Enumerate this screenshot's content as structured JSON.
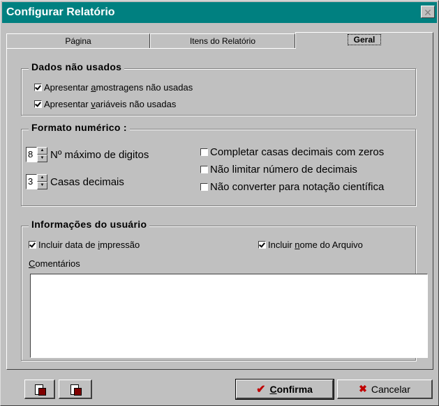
{
  "window": {
    "title": "Configurar Relatório",
    "close_glyph": "✕"
  },
  "tabs": [
    {
      "label": "Página"
    },
    {
      "label": "Itens do Relatório"
    },
    {
      "label": "Geral",
      "active": true
    }
  ],
  "unused": {
    "legend": "Dados não usados",
    "items": [
      {
        "pre": "Apresentar ",
        "key": "a",
        "post": "mostragens não usadas",
        "checked": true
      },
      {
        "pre": "Apresentar ",
        "key": "v",
        "post": "ariáveis não usadas",
        "checked": true
      }
    ]
  },
  "numeric": {
    "legend": "Formato numérico :",
    "max_digits": {
      "value": "8",
      "label": "Nº máximo de digitos"
    },
    "decimals": {
      "value": "3",
      "label": "Casas decimais"
    },
    "options": [
      {
        "label": "Completar casas decimais com zeros",
        "checked": false
      },
      {
        "label": "Não limitar número de decimais",
        "checked": false
      },
      {
        "label": "Não converter para notação científica",
        "checked": false
      }
    ]
  },
  "user_info": {
    "legend": "Informações do usuário",
    "print_date": {
      "pre": "Incluir data de ",
      "key": "i",
      "post": "mpressão",
      "checked": true
    },
    "file_name": {
      "pre": "Incluir ",
      "key": "n",
      "post": "ome do Arquivo",
      "checked": true
    },
    "comments": {
      "key": "C",
      "post": "omentários",
      "value": ""
    }
  },
  "buttons": {
    "confirm": {
      "key": "C",
      "post": "onfirma",
      "icon": "checkmark-icon"
    },
    "cancel": {
      "label": "Cancelar",
      "icon": "cancel-x-icon"
    },
    "tool1_icon": "document-icon",
    "tool2_icon": "document-icon"
  },
  "colors": {
    "titlebar": "#008080",
    "face": "#c0c0c0",
    "accent_red": "#c00000"
  }
}
